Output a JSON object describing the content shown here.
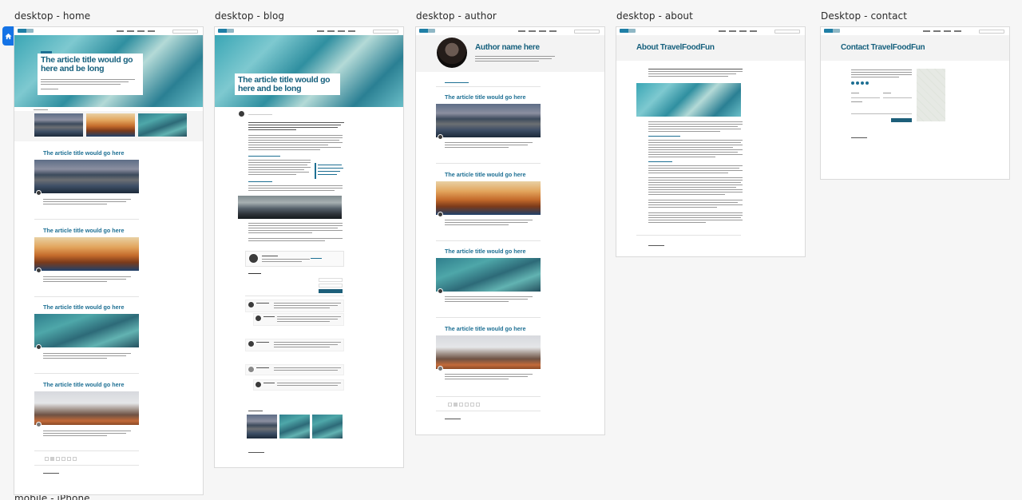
{
  "artboards": {
    "home": {
      "label": "desktop - home",
      "hero_title": "The article title would go here and be long",
      "card_title": "The article title would go here"
    },
    "blog": {
      "label": "desktop - blog",
      "hero_title": "The article title would go here and be long"
    },
    "author": {
      "label": "desktop - author",
      "heading": "Author name here",
      "card_title": "The article title would go here"
    },
    "about": {
      "label": "desktop - about",
      "heading": "About TravelFoodFun"
    },
    "contact": {
      "label": "Desktop - contact",
      "heading": "Contact TravelFoodFun"
    }
  },
  "bottom_label": "mobile - iPhone",
  "colors": {
    "brand": "#16607d",
    "accent": "#1473e6",
    "canvas": "#f6f6f6"
  },
  "icons": {
    "home_tab": "home-icon"
  }
}
